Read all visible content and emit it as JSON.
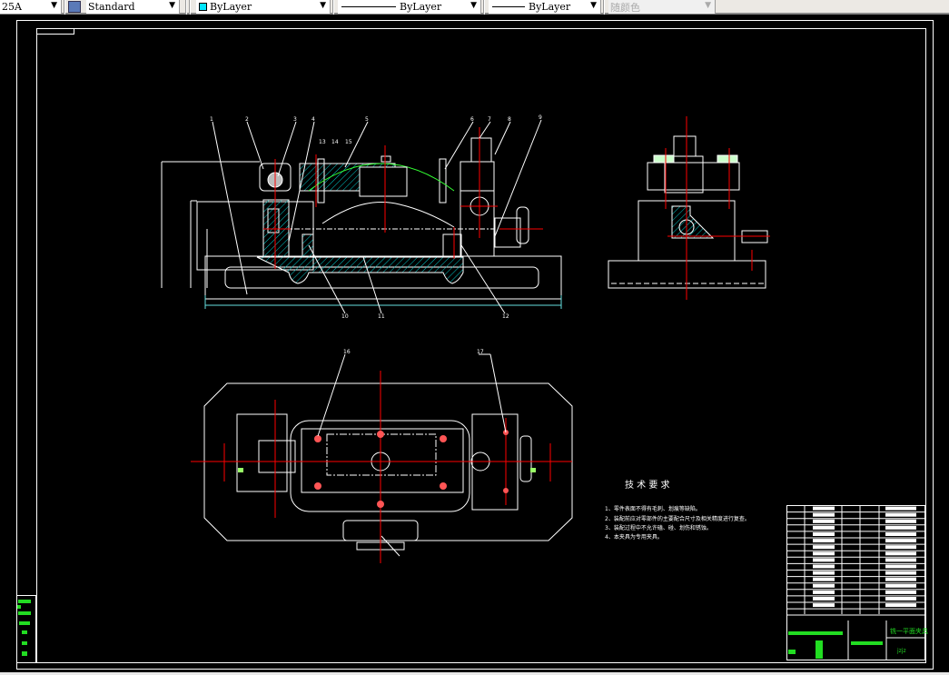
{
  "toolbar": {
    "dimstyle_value": "25A",
    "textstyle_value": "Standard",
    "layer_color_value": "ByLayer",
    "linetype_value": "ByLayer",
    "lineweight_value": "ByLayer",
    "plotstyle_value": "随颜色",
    "layer_color_swatch": "#00e5ff"
  },
  "drawing": {
    "colors": {
      "outline": "#ffffff",
      "centerline": "#ff0000",
      "hatch": "#00c8c8",
      "dimension": "#66e0e0",
      "highlight": "#33ff33"
    },
    "part_labels": [
      "1",
      "2",
      "3",
      "4",
      "5",
      "6",
      "7",
      "8",
      "9",
      "10",
      "11",
      "12",
      "13",
      "14",
      "15",
      "16",
      "17"
    ],
    "tech_requirements": {
      "title": "技 术 要 求",
      "items": [
        "1、零件表面不得有毛刺、划痕等缺陷。",
        "2、装配前应对零部件的主要配合尺寸及相关精度进行复查。",
        "3、装配过程中不允许磕、碰、划伤和锈蚀。",
        "4、本夹具为专用夹具。"
      ]
    },
    "title_block": {
      "drawing_name": "铣一平面夹具",
      "code": "jzjz"
    }
  }
}
